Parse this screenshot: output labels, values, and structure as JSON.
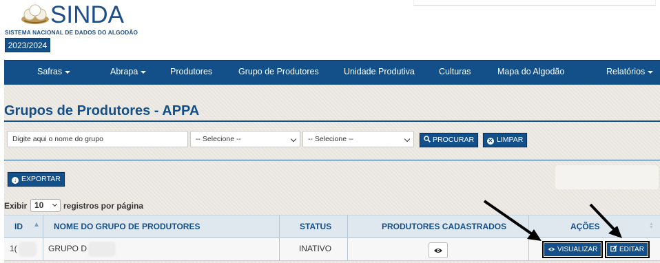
{
  "header": {
    "logo_text": "SINDA",
    "logo_subtitle": "SISTEMA NACIONAL DE DADOS DO ALGODÃO",
    "season": "2023/2024"
  },
  "nav": {
    "items": [
      {
        "label": "Safras",
        "dropdown": true
      },
      {
        "label": "Abrapa",
        "dropdown": true
      },
      {
        "label": "Produtores",
        "dropdown": false
      },
      {
        "label": "Grupo de Produtores",
        "dropdown": false
      },
      {
        "label": "Unidade Produtiva",
        "dropdown": false
      },
      {
        "label": "Culturas",
        "dropdown": false
      },
      {
        "label": "Mapa do Algodão",
        "dropdown": false
      },
      {
        "label": "Relatórios",
        "dropdown": true
      }
    ]
  },
  "page": {
    "title": "Grupos de Produtores - APPA"
  },
  "filters": {
    "search_placeholder": "Digite aqui o nome do grupo",
    "select1_value": "-- Selecione --",
    "select2_value": "-- Selecione --",
    "search_button": "PROCURAR",
    "clear_button": "LIMPAR"
  },
  "toolbar": {
    "export_button": "EXPORTAR"
  },
  "pagination": {
    "prefix": "Exibir",
    "page_size": "10",
    "suffix": "registros por página"
  },
  "table": {
    "columns": [
      "ID",
      "NOME DO GRUPO DE PRODUTORES",
      "STATUS",
      "PRODUTORES CADASTRADOS",
      "AÇÕES"
    ],
    "rows": [
      {
        "id": "1(",
        "name": "GRUPO D",
        "status": "INATIVO",
        "view_label": "VISUALIZAR",
        "edit_label": "EDITAR"
      }
    ]
  },
  "colors": {
    "primary": "#13508a",
    "background": "#ece8e2",
    "header_row": "#dfe7ef"
  }
}
